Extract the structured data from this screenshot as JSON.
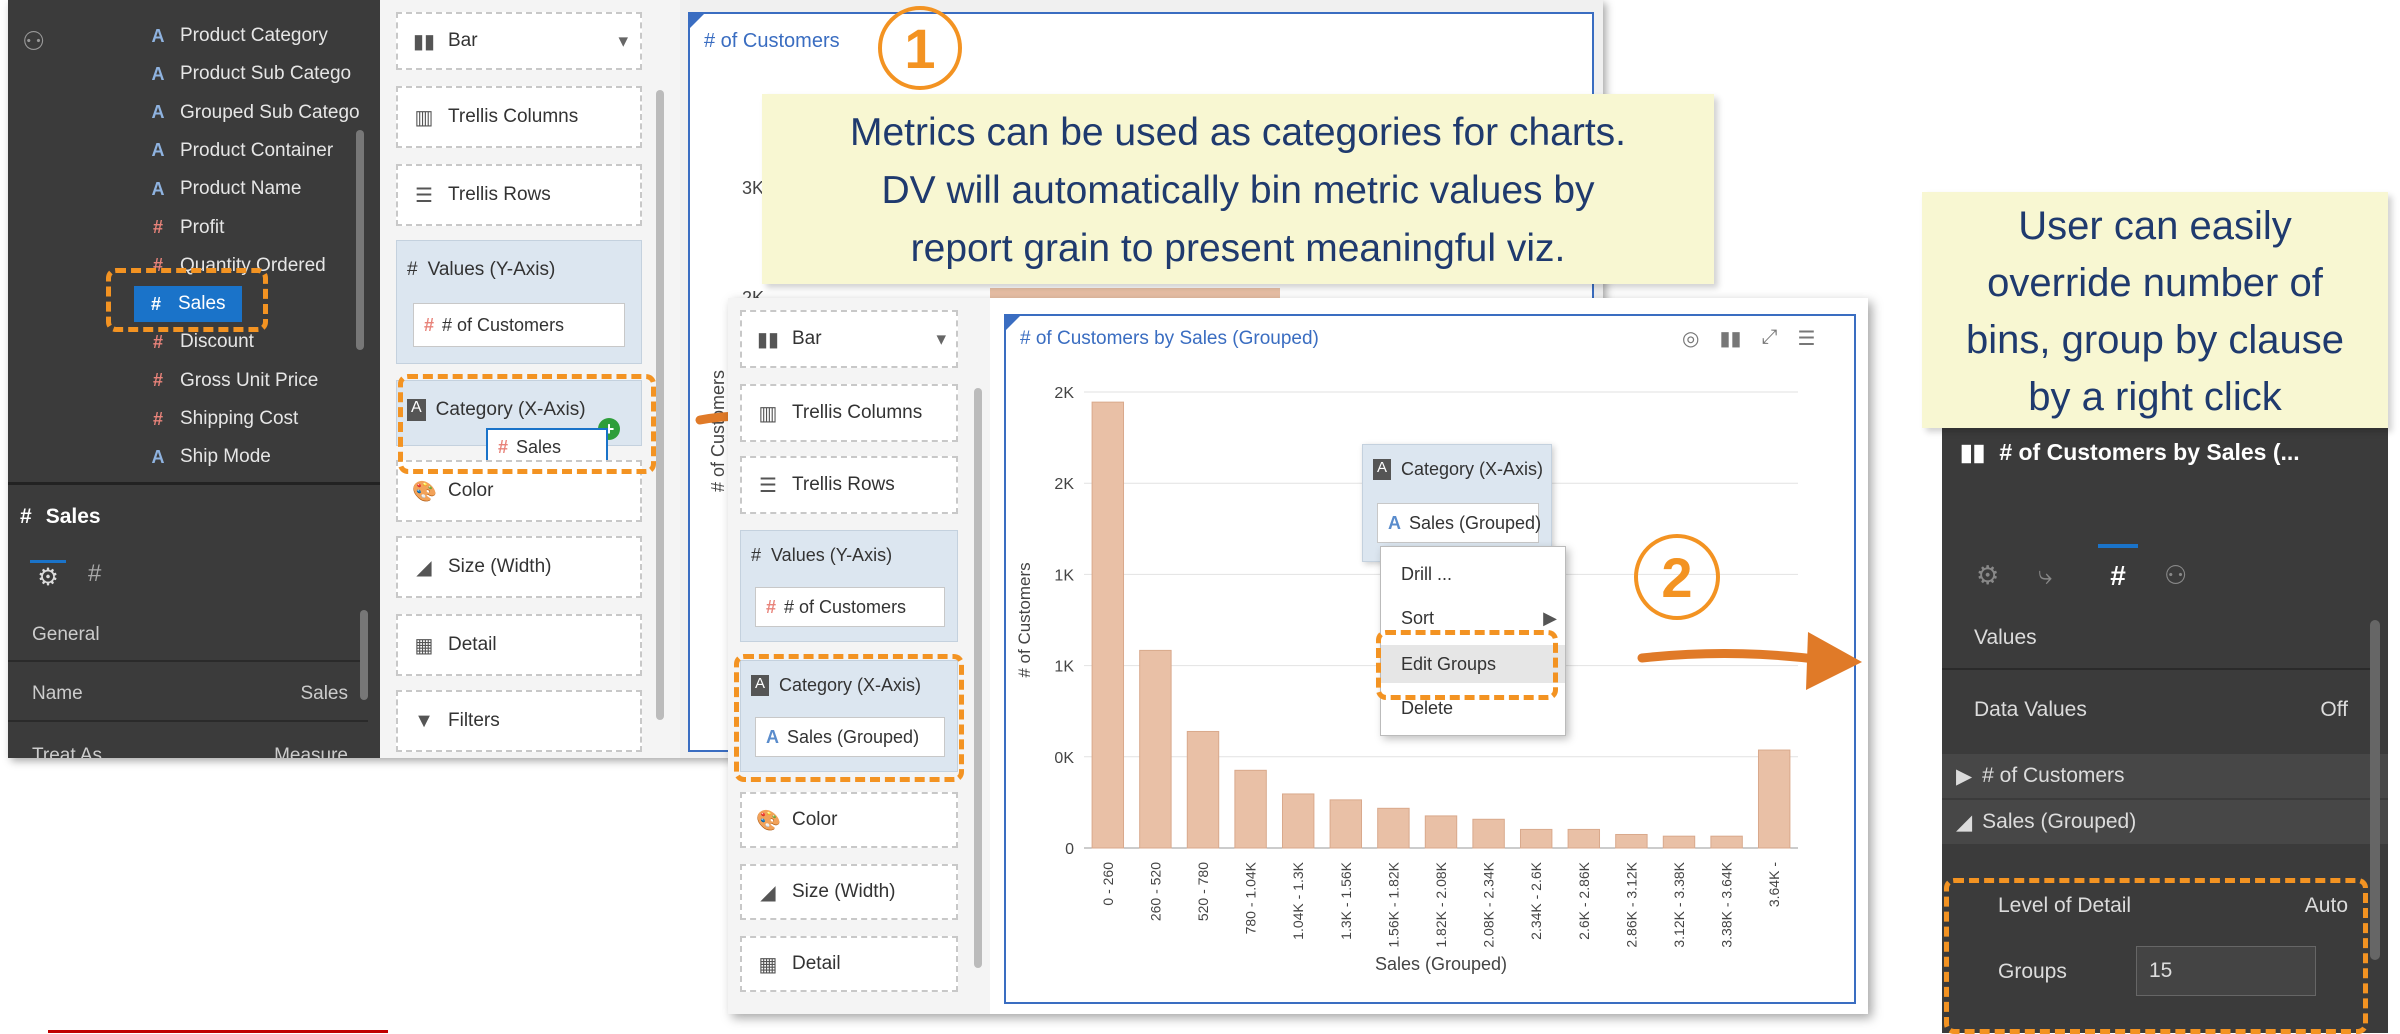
{
  "left_panel": {
    "columns": [
      {
        "name": "Product Category",
        "type": "A"
      },
      {
        "name": "Product Sub Catego",
        "type": "A"
      },
      {
        "name": "Grouped Sub Catego",
        "type": "A"
      },
      {
        "name": "Product Container",
        "type": "A"
      },
      {
        "name": "Product Name",
        "type": "A"
      },
      {
        "name": "Profit",
        "type": "#"
      },
      {
        "name": "Quantity Ordered",
        "type": "#"
      },
      {
        "name": "Sales",
        "type": "#"
      },
      {
        "name": "Discount",
        "type": "#"
      },
      {
        "name": "Gross Unit Price",
        "type": "#"
      },
      {
        "name": "Shipping Cost",
        "type": "#"
      },
      {
        "name": "Ship Mode",
        "type": "A"
      }
    ],
    "props_title": "Sales",
    "general_label": "General",
    "name_label": "Name",
    "name_value": "Sales",
    "treat_as_label": "Treat As",
    "treat_as_value": "Measure"
  },
  "grammar1": {
    "chart_type": "Bar",
    "trellis_columns": "Trellis Columns",
    "trellis_rows": "Trellis Rows",
    "values_label": "Values (Y-Axis)",
    "values_pill": "# of Customers",
    "category_label": "Category (X-Axis)",
    "drag_pill": "Sales",
    "color": "Color",
    "size": "Size (Width)",
    "detail": "Detail",
    "filters": "Filters"
  },
  "canvas1": {
    "title": "# of Customers",
    "y_ticks": [
      "3K",
      "2K"
    ],
    "y_axis_label": "# of Customers"
  },
  "callout1": {
    "number": "1",
    "text_lines": [
      "Metrics can be used as categories for charts.",
      "DV will automatically bin metric values by",
      "report grain to present meaningful viz."
    ]
  },
  "grammar2": {
    "chart_type": "Bar",
    "trellis_columns": "Trellis Columns",
    "trellis_rows": "Trellis Rows",
    "values_label": "Values (Y-Axis)",
    "values_pill": "# of Customers",
    "category_label": "Category (X-Axis)",
    "category_pill": "Sales (Grouped)",
    "color": "Color",
    "size": "Size (Width)",
    "detail": "Detail"
  },
  "chart2": {
    "title": "# of Customers by Sales (Grouped)",
    "popup_label": "Category (X-Axis)",
    "popup_pill": "Sales (Grouped)",
    "menu": [
      "Drill ...",
      "Sort",
      "Edit Groups",
      "Delete"
    ],
    "number": "2"
  },
  "chart_data": {
    "type": "bar",
    "title": "# of Customers by Sales (Grouped)",
    "xlabel": "Sales (Grouped)",
    "ylabel": "# of Customers",
    "y_tick_labels": [
      "0",
      "0K",
      "1K",
      "1K",
      "2K",
      "2K"
    ],
    "categories": [
      "0 - 260",
      "260 - 520",
      "520 - 780",
      "780 - 1.04K",
      "1.04K - 1.3K",
      "1.3K - 1.56K",
      "1.56K - 1.82K",
      "1.82K - 2.08K",
      "2.08K - 2.34K",
      "2.34K - 2.6K",
      "2.6K - 2.86K",
      "2.86K - 3.12K",
      "3.12K - 3.38K",
      "3.38K - 3.64K",
      "3.64K -"
    ],
    "values": [
      2640,
      1170,
      690,
      460,
      320,
      285,
      235,
      190,
      170,
      110,
      110,
      80,
      70,
      70,
      580
    ],
    "ylim": [
      0,
      2700
    ],
    "grid": true
  },
  "right_panel": {
    "callout_lines": [
      "User can easily",
      "override number of",
      "bins, group by clause",
      "by a right click"
    ],
    "header_title": "# of Customers by Sales (...",
    "values_label": "Values",
    "data_values_label": "Data Values",
    "data_values_value": "Off",
    "section_customers": "# of Customers",
    "section_sales": "Sales (Grouped)",
    "lod_label": "Level of Detail",
    "lod_value": "Auto",
    "groups_label": "Groups",
    "groups_value": "15"
  },
  "colors": {
    "accent_orange": "#f39322",
    "bar_fill": "#e9c0a6",
    "callout_bg": "#f8f7d2",
    "callout_text": "#1f3a6e",
    "selected_blue": "#1a73c9"
  }
}
